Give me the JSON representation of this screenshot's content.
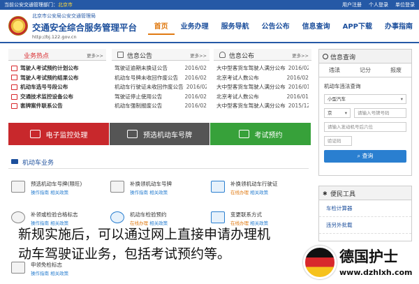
{
  "topbar": {
    "dept_prefix": "当前公安交通管理部门：",
    "dept_city": "北京市",
    "links": [
      "用户注册",
      "个人登录",
      "单位登录"
    ]
  },
  "header": {
    "org": "北京市公安局公安交通管理局",
    "title": "交通安全综合服务管理平台",
    "url": "http://bj.122.gov.cn"
  },
  "nav": [
    "首页",
    "业务办理",
    "服务导航",
    "公告公布",
    "信息查询",
    "APP下载",
    "办事指南"
  ],
  "hot": {
    "title": "业务热点",
    "more": "更多>>",
    "items": [
      "驾驶人考试预约计划公布",
      "驾驶人考试预约结果公布",
      "机动车选号号段公布",
      "交通技术监控设备公布",
      "套牌案件联系公告"
    ]
  },
  "notice": {
    "title": "信息公告",
    "more": "更多>>",
    "items": [
      {
        "t": "驾驶证逾期未换证公告",
        "d": "2016/02"
      },
      {
        "t": "机动车号牌未收回作废公告",
        "d": "2016/02"
      },
      {
        "t": "机动车行驶证未收回作废公告",
        "d": "2016/02"
      },
      {
        "t": "驾驶证停止使用公告",
        "d": "2016/02"
      },
      {
        "t": "机动车强制报废公告",
        "d": "2016/02"
      }
    ]
  },
  "publish": {
    "title": "信息公布",
    "more": "更多>>",
    "items": [
      {
        "t": "大中型客货车驾驶人满分公布",
        "d": "2016/02"
      },
      {
        "t": "北京考试人数公布",
        "d": "2016/02"
      },
      {
        "t": "大中型客货车驾驶人满分公布",
        "d": "2016/01"
      },
      {
        "t": "北京考试人数公布",
        "d": "2016/01"
      },
      {
        "t": "大中型客货车驾驶人满分公布",
        "d": "2015/12"
      }
    ]
  },
  "bands": [
    {
      "label": "电子监控处理",
      "color": "#c8282c"
    },
    {
      "label": "预选机动车号牌",
      "color": "#555555"
    },
    {
      "label": "考试预约",
      "color": "#37a13a"
    }
  ],
  "section": {
    "title": "机动车业务"
  },
  "services": [
    {
      "name": "预选机动车号牌(限旺)",
      "op": "操作指南",
      "rel": "相关政策"
    },
    {
      "name": "补换领机动车号牌",
      "op": "操作指南",
      "rel": "相关政策"
    },
    {
      "name": "补换领机动车行驶证",
      "op": "在线办理",
      "rel": "相关政策"
    },
    {
      "name": "补领或检验合格标志",
      "op": "操作指南",
      "rel": "相关政策"
    },
    {
      "name": "机动车检验预约",
      "op": "在线办理",
      "rel": "相关政策"
    },
    {
      "name": "变更联系方式",
      "op": "在线办理",
      "rel": "相关政策"
    },
    {
      "name": "申领免检标志",
      "op": "操作指南",
      "rel": "相关政策"
    }
  ],
  "query": {
    "title": "信息查询",
    "tabs": [
      "违法",
      "记分",
      "报废"
    ],
    "subtitle": "机动车违法查询",
    "vehicle_type": "小型汽车",
    "province": "京",
    "plate_placeholder": "请输入号牌号码",
    "engine_placeholder": "请输入发动机号后六位",
    "captcha_placeholder": "验证码",
    "button": "查询"
  },
  "tools": {
    "title": "便民工具",
    "items": [
      "车检计算器",
      "违另外批载"
    ]
  },
  "caption": {
    "line1": "新规实施后，可以通过网上直接申请办理机",
    "line2": "动车驾驶证业务，包括考试预约等。"
  },
  "watermark": {
    "name": "德国护士",
    "url": "www.dzhlxh.com"
  }
}
